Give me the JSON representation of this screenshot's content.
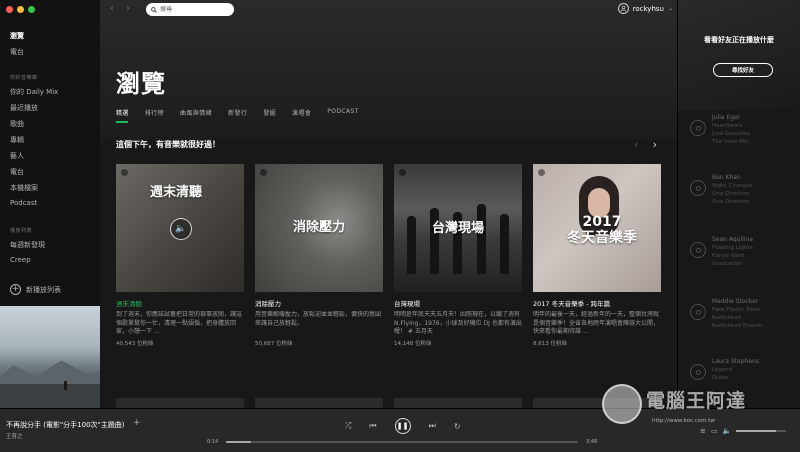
{
  "sidebar": {
    "items": [
      {
        "label": "瀏覽",
        "active": true
      },
      {
        "label": "電台",
        "active": false
      }
    ],
    "library_title": "你的音樂庫",
    "library": [
      "你的 Daily Mix",
      "最近播放",
      "歌曲",
      "專輯",
      "藝人",
      "電台",
      "本機檔案",
      "Podcast"
    ],
    "playlists_title": "播放列表",
    "playlists": [
      "每週新發現",
      "Creep"
    ],
    "new_playlist": "新播放列表"
  },
  "topbar": {
    "search_placeholder": "搜尋",
    "username": "rockyhsu"
  },
  "main": {
    "title": "瀏覽",
    "tabs": [
      "精選",
      "排行榜",
      "曲風與情緒",
      "新發行",
      "發掘",
      "演唱會",
      "PODCAST"
    ],
    "active_tab": 0,
    "section_title": "這個下午，有音樂就很好過！",
    "cards": [
      {
        "image_text": "週末清聽",
        "title": "週末清聽",
        "desc": "到了週末，你應該試著把日常的瑣事放開，讓這個歌單幫你一忙，清理一點煩惱，把身體放回家，小憩一下 …",
        "followers": "40,543 位粉絲",
        "highlight": true
      },
      {
        "image_text": "消除壓力",
        "title": "消除壓力",
        "desc": "用音樂解緩壓力，放鬆迎並並輕鬆，慵快的氛圍來讓自己放輕鬆。",
        "followers": "50,687 位粉絲",
        "highlight": false
      },
      {
        "image_text": "台灣現場",
        "title": "台灣現場",
        "desc": "明明是年底天天五月天！因照現在，以聽了週有 N.Flying，1976，小球及好機位 DJ 也都有演出喔！ # 五月天",
        "followers": "14,148 位粉絲",
        "highlight": false
      },
      {
        "image_text_line1": "2017",
        "image_text_line2": "冬天音樂季",
        "title": "2017 冬天音樂季 - 跨年篇",
        "desc": "明年的最後一天，經過新年的一天，整個台灣就是個音樂季！全省各地跨年演唱會陣容大公開，快來看你最期待誰 …",
        "followers": "8,613 位粉絲",
        "highlight": false
      }
    ]
  },
  "friends": {
    "title": "看看好友正在播放什麼",
    "find_button": "尋找好友",
    "list": [
      {
        "name": "Julia Eger",
        "track": "Heartbeats",
        "artist": "José González",
        "context": "The Indie Mix"
      },
      {
        "name": "Ben Khan",
        "track": "Night Changes",
        "artist": "One Direction",
        "context": "One Direction"
      },
      {
        "name": "Sean Aquilina",
        "track": "Floating Lights",
        "artist": "Kanye West",
        "context": "Graduation"
      },
      {
        "name": "Maddie Stocker",
        "track": "Fake Plastic Trees",
        "artist": "Radiohead",
        "context": "Radiohead Essenti..."
      },
      {
        "name": "Laura Stephens",
        "track": "Legend",
        "artist": "Drake",
        "context": ""
      }
    ]
  },
  "player": {
    "track_title": "不再說分手 (電影\"分手100次\"主題曲)",
    "artist": "王育之",
    "time_current": "0:14",
    "time_total": "3:48",
    "progress": 0.07,
    "volume": 0.8
  },
  "watermark": {
    "text": "電腦王阿達",
    "url": "http://www.koc.com.tw"
  }
}
